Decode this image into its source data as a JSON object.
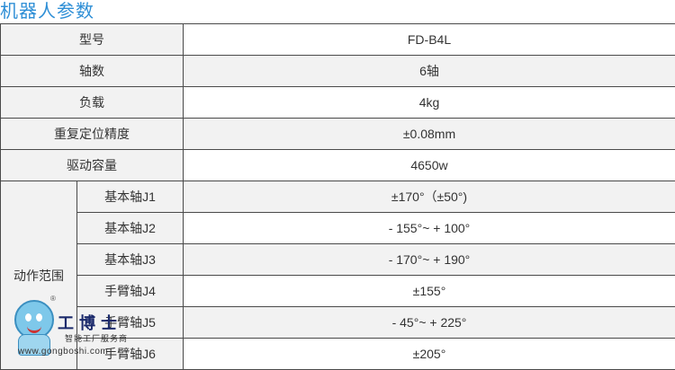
{
  "title": "机器人参数",
  "specs": [
    {
      "label": "型号",
      "value": "FD-B4L"
    },
    {
      "label": "轴数",
      "value": "6轴"
    },
    {
      "label": "负载",
      "value": "4kg"
    },
    {
      "label": "重复定位精度",
      "value": "±0.08mm"
    },
    {
      "label": "驱动容量",
      "value": "4650w"
    }
  ],
  "range": {
    "label": "动作范围",
    "axes": [
      {
        "name": "基本轴J1",
        "value": "±170°（±50°)"
      },
      {
        "name": "基本轴J2",
        "value": "- 155°~ + 100°"
      },
      {
        "name": "基本轴J3",
        "value": "- 170°~ + 190°"
      },
      {
        "name": "手臂轴J4",
        "value": "±155°"
      },
      {
        "name": "手臂轴J5",
        "value": "- 45°~ + 225°"
      },
      {
        "name": "手臂轴J6",
        "value": "±205°"
      }
    ]
  },
  "watermark": {
    "brand": "工博士",
    "registered": "®",
    "tagline": "智能工厂服务商",
    "url": "www.gongboshi.com"
  },
  "colors": {
    "title": "#2f8fd6",
    "border": "#4a4a4a",
    "shade": "#f2f2f2"
  }
}
